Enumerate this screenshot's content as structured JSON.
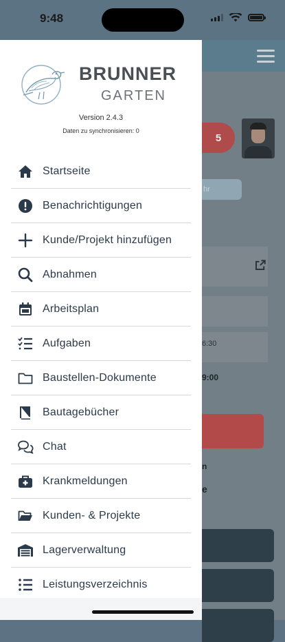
{
  "status_bar": {
    "time": "9:48"
  },
  "brand": {
    "name": "BRUNNER",
    "sub": "GARTEN",
    "version": "Version 2.4.3",
    "sync": "Daten zu synchronisieren: 0"
  },
  "menu": [
    {
      "label": "Startseite",
      "icon": "home-icon"
    },
    {
      "label": "Benachrichtigungen",
      "icon": "alert-circle-icon"
    },
    {
      "label": "Kunde/Projekt hinzufügen",
      "icon": "plus-icon"
    },
    {
      "label": "Abnahmen",
      "icon": "search-icon"
    },
    {
      "label": "Arbeitsplan",
      "icon": "calendar-icon"
    },
    {
      "label": "Aufgaben",
      "icon": "checklist-icon"
    },
    {
      "label": "Baustellen-Dokumente",
      "icon": "folder-icon"
    },
    {
      "label": "Bautagebücher",
      "icon": "book-icon"
    },
    {
      "label": "Chat",
      "icon": "chat-icon"
    },
    {
      "label": "Krankmeldungen",
      "icon": "medkit-icon"
    },
    {
      "label": "Kunden- & Projekte",
      "icon": "folder-open-icon"
    },
    {
      "label": "Lagerverwaltung",
      "icon": "warehouse-icon"
    },
    {
      "label": "Leistungsverzeichnis",
      "icon": "list-icon"
    }
  ],
  "background": {
    "badge_count": "5",
    "pill_text": "hr",
    "time_text_1": "6:30",
    "time_text_2": "9:00",
    "text_1": "n",
    "text_2": "e"
  },
  "colors": {
    "accent": "#2b3a4a",
    "overlay": "#5d7383",
    "badge": "#b04b4b"
  }
}
